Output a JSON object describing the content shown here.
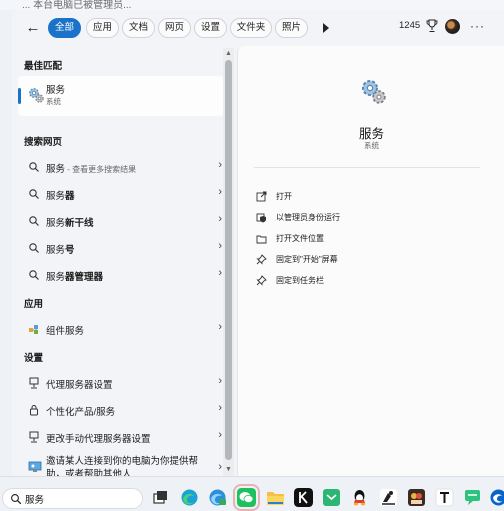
{
  "top_strip_text": "... 本台电脑已被管理员...",
  "header": {
    "back_label": "←",
    "tabs": [
      {
        "label": "全部",
        "active": true
      },
      {
        "label": "应用",
        "active": false
      },
      {
        "label": "文档",
        "active": false
      },
      {
        "label": "网页",
        "active": false
      },
      {
        "label": "设置",
        "active": false
      },
      {
        "label": "文件夹",
        "active": false
      },
      {
        "label": "照片",
        "active": false
      }
    ],
    "more_icon": "play-icon",
    "points": "1245",
    "rewards_icon": "trophy-icon",
    "menu_label": "···"
  },
  "left": {
    "best_match_header": "最佳匹配",
    "best_match": {
      "title": "服务",
      "subtitle": "系统",
      "icon": "services-gear-icon"
    },
    "web_header": "搜索网页",
    "web_results": [
      {
        "prefix": "服务",
        "bold": "",
        "suffix": " - 查看更多搜索结果"
      },
      {
        "prefix": "服务",
        "bold": "器",
        "suffix": ""
      },
      {
        "prefix": "服务",
        "bold": "新干线",
        "suffix": ""
      },
      {
        "prefix": "服务",
        "bold": "号",
        "suffix": ""
      },
      {
        "prefix": "服务",
        "bold": "器管理器",
        "suffix": ""
      }
    ],
    "apps_header": "应用",
    "apps": [
      {
        "label": "组件服务",
        "icon": "component-services-icon"
      }
    ],
    "settings_header": "设置",
    "settings": [
      {
        "label": "代理服务器设置",
        "icon": "proxy-icon"
      },
      {
        "label": "个性化产品/服务",
        "icon": "lock-icon"
      },
      {
        "label": "更改手动代理服务器设置",
        "icon": "proxy-icon"
      },
      {
        "label": "邀请某人连接到你的电脑为你提供帮助，或者帮助其他人",
        "icon": "remote-assist-icon"
      }
    ]
  },
  "detail": {
    "title": "服务",
    "subtitle": "系统",
    "actions": [
      {
        "label": "打开",
        "icon": "open-icon"
      },
      {
        "label": "以管理员身份运行",
        "icon": "shield-icon"
      },
      {
        "label": "打开文件位置",
        "icon": "folder-icon"
      },
      {
        "label": "固定到\"开始\"屏幕",
        "icon": "pin-icon"
      },
      {
        "label": "固定到任务栏",
        "icon": "pin-icon"
      }
    ]
  },
  "taskbar": {
    "search_value": "服务",
    "apps": [
      "task-view-icon",
      "edge-icon",
      "edge-beta-icon",
      "wechat-icon",
      "file-explorer-icon",
      "kimi-icon",
      "app-green-icon",
      "qq-icon",
      "app-skate-icon",
      "app-game-icon",
      "typora-icon",
      "chat-icon",
      "app-edge-icon"
    ]
  }
}
